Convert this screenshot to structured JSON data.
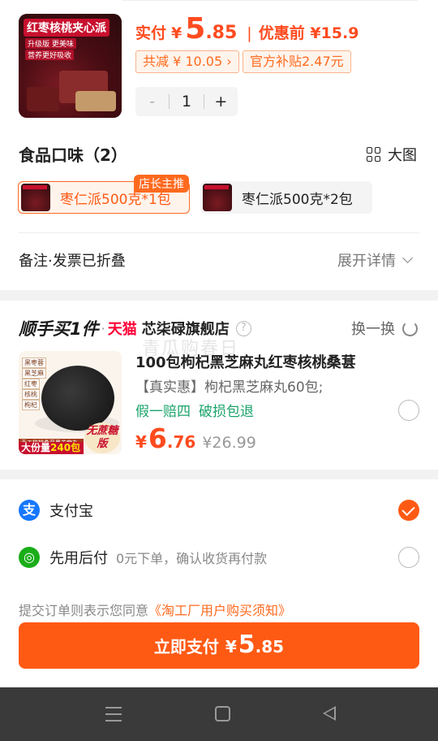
{
  "product": {
    "image_banner": "红枣核桃夹心派",
    "image_tags": [
      "升级版 更美味",
      "营养更好吸收"
    ],
    "paid_label": "实付",
    "currency": "¥",
    "price_int": "5",
    "price_dec": ".85",
    "orig_price": "优惠前 ¥15.9",
    "discount_total": "共减 ¥ 10.05",
    "subsidy": "官方补贴2.47元",
    "quantity": "1",
    "minus_label": "-",
    "plus_label": "+"
  },
  "flavor": {
    "title": "食品口味（2）",
    "bigview_label": "大图",
    "recommend_badge": "店长主推",
    "options": [
      {
        "label": "枣仁派500克*1包",
        "selected": true
      },
      {
        "label": "枣仁派500克*2包",
        "selected": false
      }
    ]
  },
  "remark": {
    "label": "备注·发票已折叠",
    "expand_label": "展开详情"
  },
  "addon": {
    "brand": "顺手买1件",
    "dot": "·",
    "platform": "天猫",
    "store": "芯柒碌旗舰店",
    "help": "?",
    "swap_label": "换一换",
    "image_side_labels": [
      "黑枣蓉",
      "黑芝麻",
      "红枣",
      "核桃",
      "枸杞"
    ],
    "image_bottom_text": "手工核桃桑葚黑芝麻丸",
    "image_pack_prefix": "大份量",
    "image_pack_count": "240包",
    "image_nosugar": "无蔗糖版",
    "title": "100包枸杞黑芝麻丸红枣核桃桑葚",
    "subtitle": "【真实惠】枸杞黑芝麻丸60包;",
    "tags": [
      "假一赔四",
      "破损包退"
    ],
    "currency": "¥",
    "price_int": "6",
    "price_dec": ".76",
    "old_price": "¥26.99"
  },
  "watermark": "青瓜购春日",
  "payment": {
    "alipay": {
      "name": "支付宝",
      "icon": "支"
    },
    "later": {
      "name": "先用后付",
      "desc": "0元下单，确认收货再付款",
      "icon": "◎"
    },
    "agree_text": "提交订单则表示您同意",
    "agree_link": "《淘工厂用户购买须知》",
    "button_label": "立即支付",
    "button_currency": "¥",
    "button_int": "5",
    "button_dec": ".85"
  },
  "colors": {
    "accent": "#ff5a14",
    "tmall": "#ff0036",
    "green": "#1aa36b"
  }
}
